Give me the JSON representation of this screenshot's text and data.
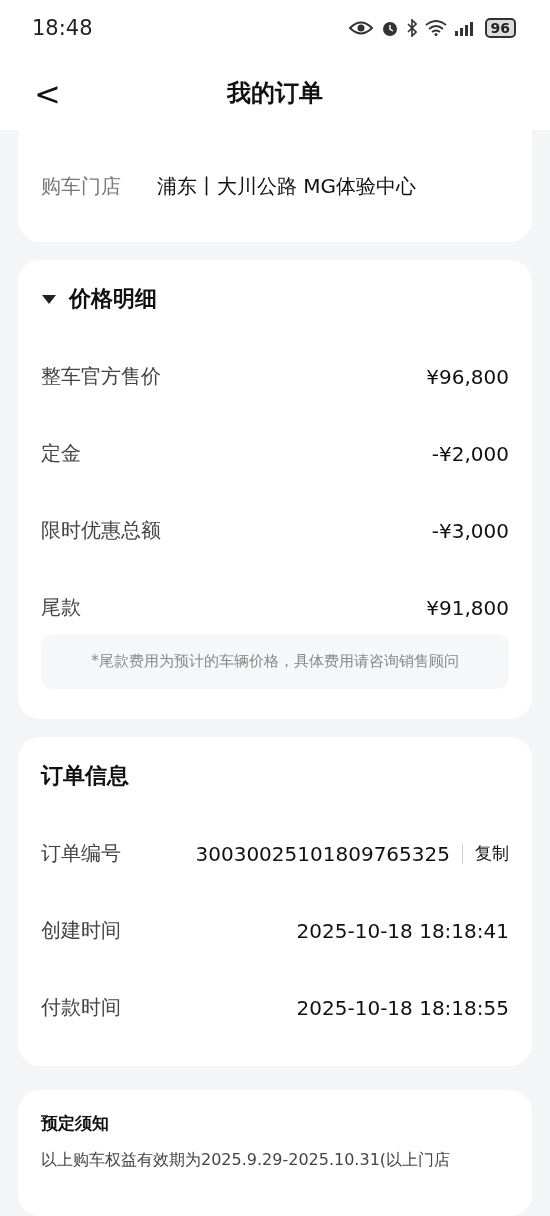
{
  "status_bar": {
    "time": "18:48",
    "battery": "96"
  },
  "header": {
    "back": "<",
    "title": "我的订单"
  },
  "store": {
    "label": "购车门店",
    "value": "浦东丨大川公路 MG体验中心"
  },
  "price_detail": {
    "title": "价格明细",
    "expanded": true,
    "rows": [
      {
        "label": "整车官方售价",
        "value": "¥96,800"
      },
      {
        "label": "定金",
        "value": "-¥2,000"
      },
      {
        "label": "限时优惠总额",
        "value": "-¥3,000"
      },
      {
        "label": "尾款",
        "value": "¥91,800"
      }
    ],
    "note": "*尾款费用为预计的车辆价格，具体费用请咨询销售顾问"
  },
  "order_info": {
    "title": "订单信息",
    "rows": [
      {
        "kind": "copy",
        "label": "订单编号",
        "value": "30030025101809765325",
        "action": "复制"
      },
      {
        "kind": "plain",
        "label": "创建时间",
        "value": "2025-10-18 18:18:41"
      },
      {
        "kind": "plain",
        "label": "付款时间",
        "value": "2025-10-18 18:18:55"
      }
    ]
  },
  "notice": {
    "title": "预定须知",
    "text": "以上购车权益有效期为2025.9.29-2025.10.31(以上门店"
  }
}
